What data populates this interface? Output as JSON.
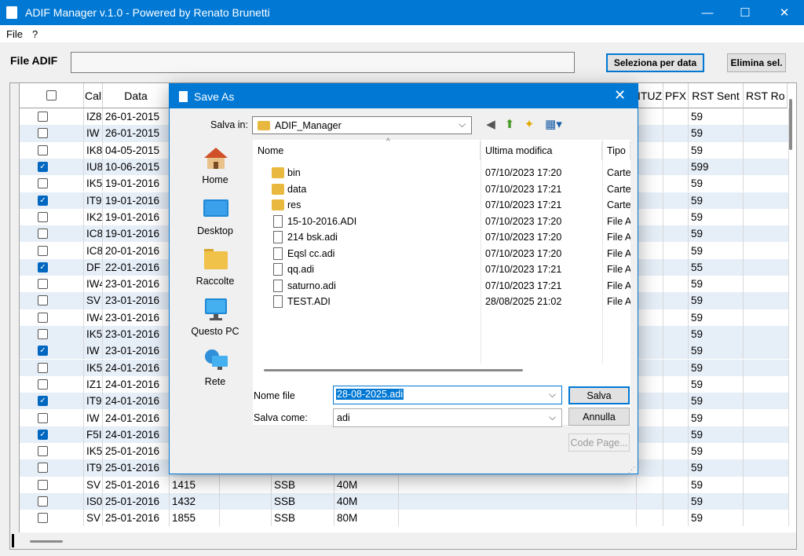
{
  "window": {
    "title": "ADIF Manager v.1.0 - Powered by Renato Brunetti",
    "minimize": "—",
    "maximize": "☐",
    "close": "✕"
  },
  "menu": [
    "File",
    "?"
  ],
  "toolbar": {
    "file_label": "File ADIF",
    "select_by_date": "Seleziona per data",
    "delete_selected": "Elimina sel."
  },
  "grid": {
    "columns_left": [
      "Call",
      "Data"
    ],
    "columns_right": [
      "ITUZ",
      "PFX",
      "RST Sent",
      "RST Ro"
    ],
    "rows": [
      {
        "checked": false,
        "call": "IZ8",
        "date": "26-01-2015",
        "time": "",
        "mode": "",
        "band": "",
        "rst": "59"
      },
      {
        "checked": false,
        "call": "IW",
        "date": "26-01-2015",
        "time": "",
        "mode": "",
        "band": "",
        "rst": "59"
      },
      {
        "checked": false,
        "call": "IK8",
        "date": "04-05-2015",
        "time": "",
        "mode": "",
        "band": "",
        "rst": "59"
      },
      {
        "checked": true,
        "call": "IU8",
        "date": "10-06-2015",
        "time": "",
        "mode": "",
        "band": "",
        "rst": "599"
      },
      {
        "checked": false,
        "call": "IK5",
        "date": "19-01-2016",
        "time": "",
        "mode": "",
        "band": "",
        "rst": "59"
      },
      {
        "checked": true,
        "call": "IT9",
        "date": "19-01-2016",
        "time": "",
        "mode": "",
        "band": "",
        "rst": "59"
      },
      {
        "checked": false,
        "call": "IK2",
        "date": "19-01-2016",
        "time": "",
        "mode": "",
        "band": "",
        "rst": "59"
      },
      {
        "checked": false,
        "call": "IC8",
        "date": "19-01-2016",
        "time": "",
        "mode": "",
        "band": "",
        "rst": "59"
      },
      {
        "checked": false,
        "call": "IC8",
        "date": "20-01-2016",
        "time": "",
        "mode": "",
        "band": "",
        "rst": "59"
      },
      {
        "checked": true,
        "call": "DF",
        "date": "22-01-2016",
        "time": "",
        "mode": "",
        "band": "",
        "rst": "55"
      },
      {
        "checked": false,
        "call": "IW4",
        "date": "23-01-2016",
        "time": "",
        "mode": "",
        "band": "",
        "rst": "59"
      },
      {
        "checked": false,
        "call": "SV",
        "date": "23-01-2016",
        "time": "",
        "mode": "",
        "band": "",
        "rst": "59"
      },
      {
        "checked": false,
        "call": "IW4",
        "date": "23-01-2016",
        "time": "",
        "mode": "",
        "band": "",
        "rst": "59"
      },
      {
        "checked": false,
        "call": "IK5",
        "date": "23-01-2016",
        "time": "",
        "mode": "",
        "band": "",
        "rst": "59"
      },
      {
        "checked": true,
        "call": "IW",
        "date": "23-01-2016",
        "time": "",
        "mode": "",
        "band": "",
        "rst": "59"
      },
      {
        "checked": false,
        "call": "IK5",
        "date": "24-01-2016",
        "time": "",
        "mode": "",
        "band": "",
        "rst": "59"
      },
      {
        "checked": false,
        "call": "IZ1",
        "date": "24-01-2016",
        "time": "",
        "mode": "",
        "band": "",
        "rst": "59"
      },
      {
        "checked": true,
        "call": "IT9",
        "date": "24-01-2016",
        "time": "",
        "mode": "",
        "band": "",
        "rst": "59"
      },
      {
        "checked": false,
        "call": "IW",
        "date": "24-01-2016",
        "time": "",
        "mode": "",
        "band": "",
        "rst": "59"
      },
      {
        "checked": true,
        "call": "F5I",
        "date": "24-01-2016",
        "time": "",
        "mode": "",
        "band": "",
        "rst": "59"
      },
      {
        "checked": false,
        "call": "IK5",
        "date": "25-01-2016",
        "time": "",
        "mode": "",
        "band": "",
        "rst": "59"
      },
      {
        "checked": false,
        "call": "IT9",
        "date": "25-01-2016",
        "time": "",
        "mode": "",
        "band": "",
        "rst": "59"
      },
      {
        "checked": false,
        "call": "SV",
        "date": "25-01-2016",
        "time": "1415",
        "mode": "SSB",
        "band": "40M",
        "rst": "59"
      },
      {
        "checked": false,
        "call": "IS0",
        "date": "25-01-2016",
        "time": "1432",
        "mode": "SSB",
        "band": "40M",
        "rst": "59"
      },
      {
        "checked": false,
        "call": "SV",
        "date": "25-01-2016",
        "time": "1855",
        "mode": "SSB",
        "band": "80M",
        "rst": "59"
      }
    ]
  },
  "dialog": {
    "title": "Save As",
    "close": "✕",
    "save_in_label": "Salva in:",
    "save_in_value": "ADIF_Manager",
    "places": [
      "Home",
      "Desktop",
      "Raccolte",
      "Questo PC",
      "Rete"
    ],
    "list_columns": {
      "name": "Nome",
      "modified": "Ultima modifica",
      "type": "Tipo"
    },
    "files": [
      {
        "name": "bin",
        "date": "07/10/2023 17:20",
        "type": "Carte",
        "folder": true
      },
      {
        "name": "data",
        "date": "07/10/2023 17:21",
        "type": "Carte",
        "folder": true
      },
      {
        "name": "res",
        "date": "07/10/2023 17:21",
        "type": "Carte",
        "folder": true
      },
      {
        "name": "15-10-2016.ADI",
        "date": "07/10/2023 17:20",
        "type": "File A",
        "folder": false
      },
      {
        "name": "214 bsk.adi",
        "date": "07/10/2023 17:20",
        "type": "File A",
        "folder": false
      },
      {
        "name": "Eqsl cc.adi",
        "date": "07/10/2023 17:20",
        "type": "File A",
        "folder": false
      },
      {
        "name": "qq.adi",
        "date": "07/10/2023 17:21",
        "type": "File A",
        "folder": false
      },
      {
        "name": "saturno.adi",
        "date": "07/10/2023 17:21",
        "type": "File A",
        "folder": false
      },
      {
        "name": "TEST.ADI",
        "date": "28/08/2025 21:02",
        "type": "File A",
        "folder": false
      }
    ],
    "filename_label": "Nome file",
    "filename_value": "28-08-2025.adi",
    "savetype_label": "Salva come:",
    "savetype_value": "adi",
    "save_button": "Salva",
    "cancel_button": "Annulla",
    "codepage_button": "Code Page..."
  }
}
